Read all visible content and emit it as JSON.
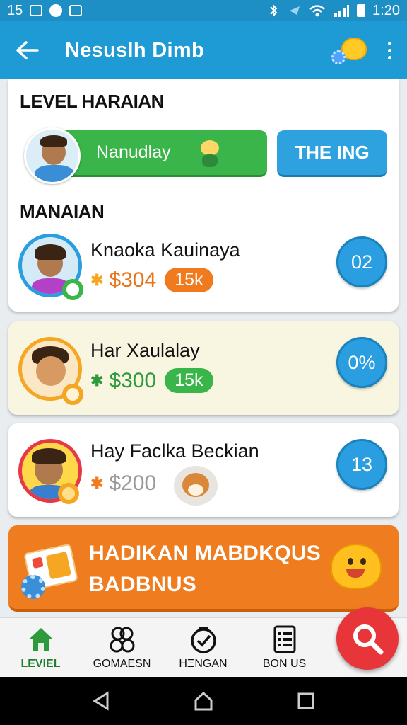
{
  "status_bar": {
    "time_left": "15",
    "time_right": "1:20"
  },
  "app_bar": {
    "title": "Nesuslh Dimb"
  },
  "level_section": {
    "heading": "LEVEL HARAIAN",
    "green_button_label": "Nanudlay",
    "blue_button_label": "THE ING"
  },
  "players_section": {
    "heading": "MANAIAN",
    "players": [
      {
        "name": "Knaoka Kauinaya",
        "amount": "$304",
        "badge": "15k",
        "rank": "02",
        "accent": "#f07a1e"
      },
      {
        "name": "Har Xaulalay",
        "amount": "$300",
        "badge": "15k",
        "rank": "0%",
        "accent": "#3ab54a"
      },
      {
        "name": "Hay Faclka Beckian",
        "amount": "$200",
        "badge": "",
        "rank": "13",
        "accent": "#f07a1e"
      }
    ]
  },
  "banner": {
    "line1": "HADIKAN MABDKQUS",
    "line2": "BADBNUS",
    "color": "#ef7c1e"
  },
  "bottom_nav": {
    "items": [
      {
        "label": "LEVIEL",
        "icon": "home-icon",
        "active": true
      },
      {
        "label": "GOMAESN",
        "icon": "group-icon",
        "active": false
      },
      {
        "label": "HΞNGAN",
        "icon": "clock-check-icon",
        "active": false
      },
      {
        "label": "BON US",
        "icon": "list-icon",
        "active": false
      }
    ]
  },
  "colors": {
    "app_bar": "#1e9bd4",
    "green": "#3ab54a",
    "blue": "#2da2de",
    "fab": "#e8353a"
  }
}
